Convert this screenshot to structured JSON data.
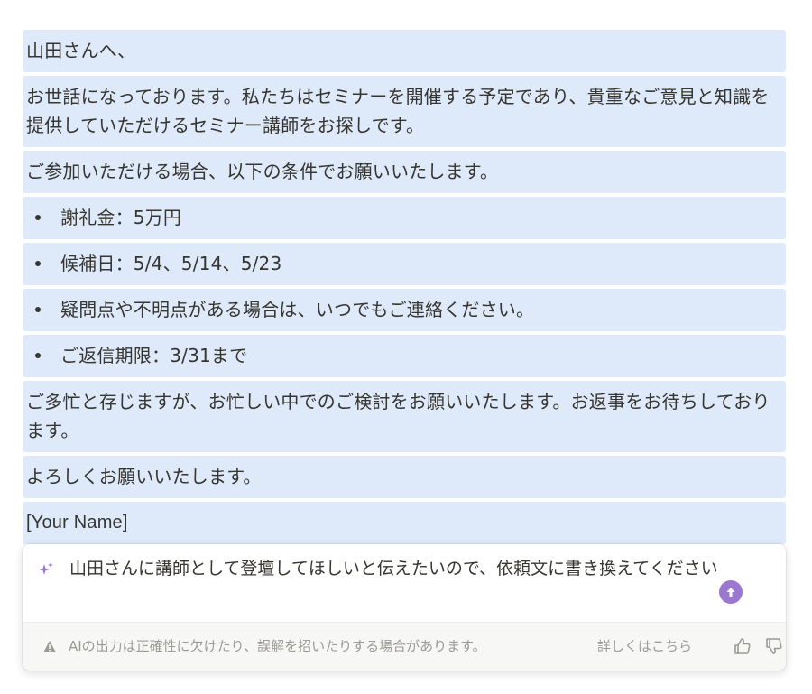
{
  "document": {
    "greeting": "山田さんへ、",
    "intro": "お世話になっております。私たちはセミナーを開催する予定であり、貴重なご意見と知識を提供していただけるセミナー講師をお探しです。",
    "conditions_intro": "ご参加いただける場合、以下の条件でお願いいたします。",
    "bullets": [
      "謝礼金：5万円",
      "候補日：5/4、5/14、5/23",
      "疑問点や不明点がある場合は、いつでもご連絡ください。",
      "ご返信期限：3/31まで"
    ],
    "closing": "ご多忙と存じますが、お忙しい中でのご検討をお願いいたします。お返事をお待ちしております。",
    "regards": "よろしくお願いいたします。",
    "signature": "[Your Name]"
  },
  "ai_prompt": {
    "text": "山田さんに講師として登壇してほしいと伝えたいので、依頼文に書き換えてください",
    "sparkle_icon": "sparkle-icon",
    "send_icon": "arrow-up-circle-icon",
    "accent_color": "#9b77cf"
  },
  "footer": {
    "disclaimer": "AIの出力は正確性に欠けたり、誤解を招いたりする場合があります。",
    "details_link": "詳しくはこちら",
    "warning_icon": "warning-icon",
    "thumbs_up_icon": "thumbs-up-icon",
    "thumbs_down_icon": "thumbs-down-icon"
  },
  "colors": {
    "highlight": "#deeafa",
    "text": "#37352f",
    "muted": "#9b9a97"
  }
}
